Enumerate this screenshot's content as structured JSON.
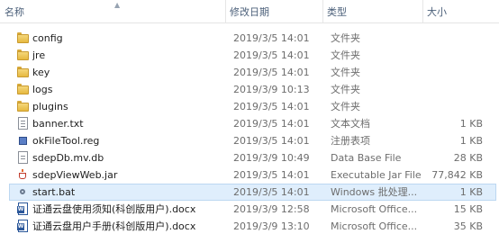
{
  "columns": {
    "name": "名称",
    "modified": "修改日期",
    "type": "类型",
    "size": "大小"
  },
  "files": [
    {
      "name": "config",
      "modified": "2019/3/5 14:01",
      "type": "文件夹",
      "size": "",
      "icon": "folder-icon"
    },
    {
      "name": "jre",
      "modified": "2019/3/5 14:01",
      "type": "文件夹",
      "size": "",
      "icon": "folder-icon"
    },
    {
      "name": "key",
      "modified": "2019/3/5 14:01",
      "type": "文件夹",
      "size": "",
      "icon": "folder-icon"
    },
    {
      "name": "logs",
      "modified": "2019/3/9 10:13",
      "type": "文件夹",
      "size": "",
      "icon": "folder-icon"
    },
    {
      "name": "plugins",
      "modified": "2019/3/5 14:01",
      "type": "文件夹",
      "size": "",
      "icon": "folder-icon"
    },
    {
      "name": "banner.txt",
      "modified": "2019/3/5 14:01",
      "type": "文本文档",
      "size": "1 KB",
      "icon": "text-file-icon"
    },
    {
      "name": "okFileTool.reg",
      "modified": "2019/3/5 14:01",
      "type": "注册表项",
      "size": "1 KB",
      "icon": "registry-file-icon"
    },
    {
      "name": "sdepDb.mv.db",
      "modified": "2019/3/9 10:49",
      "type": "Data Base File",
      "size": "28 KB",
      "icon": "database-file-icon"
    },
    {
      "name": "sdepViewWeb.jar",
      "modified": "2019/3/5 14:01",
      "type": "Executable Jar File",
      "size": "77,842 KB",
      "icon": "jar-file-icon"
    },
    {
      "name": "start.bat",
      "modified": "2019/3/5 14:01",
      "type": "Windows 批处理...",
      "size": "1 KB",
      "icon": "batch-file-icon",
      "selected": true
    },
    {
      "name": "证通云盘使用须知(科创版用户).docx",
      "modified": "2019/3/9 12:58",
      "type": "Microsoft Office...",
      "size": "15 KB",
      "icon": "word-document-icon"
    },
    {
      "name": "证通云盘用户手册(科创版用户).docx",
      "modified": "2019/3/9 13:10",
      "type": "Microsoft Office...",
      "size": "35 KB",
      "icon": "word-document-icon"
    }
  ],
  "colors": {
    "selection_bg": "#dfeefc",
    "selection_border": "#bcd7f1",
    "header_text": "#4c607a"
  }
}
